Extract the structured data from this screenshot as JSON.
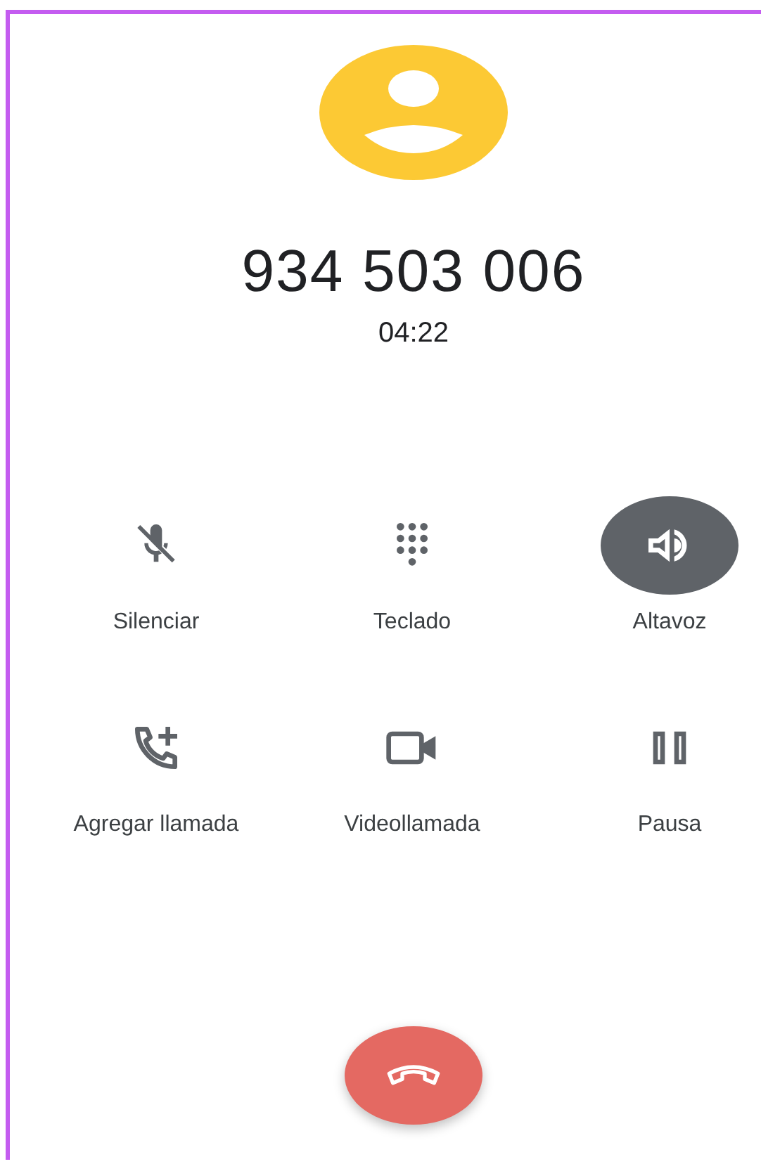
{
  "caller": {
    "number": "934 503 006",
    "duration": "04:22"
  },
  "controls": [
    {
      "kind": "mute",
      "label": "Silenciar",
      "selected": false
    },
    {
      "kind": "keypad",
      "label": "Teclado",
      "selected": false
    },
    {
      "kind": "speaker",
      "label": "Altavoz",
      "selected": true
    },
    {
      "kind": "add-call",
      "label": "Agregar llamada",
      "selected": false
    },
    {
      "kind": "video",
      "label": "Videollamada",
      "selected": false
    },
    {
      "kind": "pause",
      "label": "Pausa",
      "selected": false
    }
  ]
}
